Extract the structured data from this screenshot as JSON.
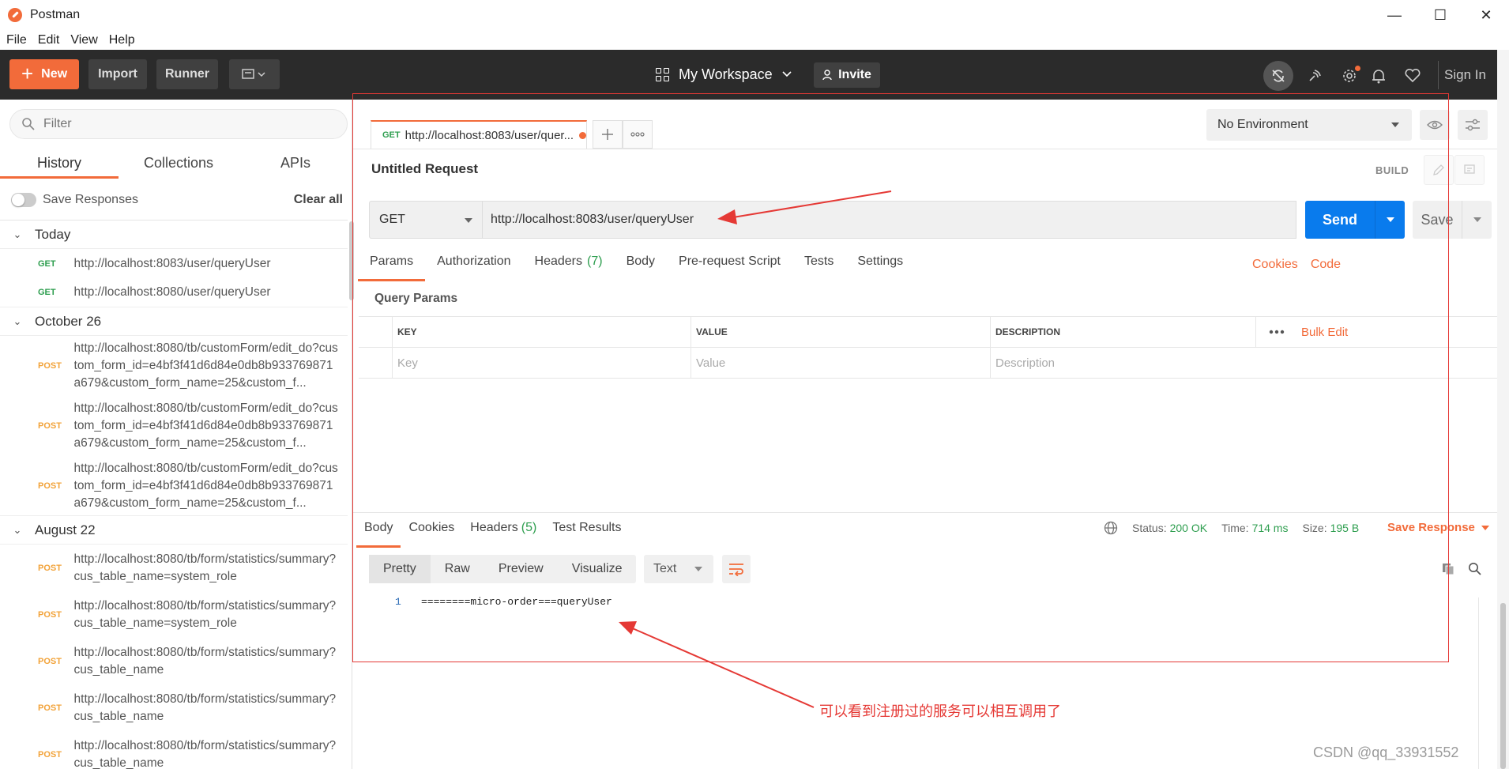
{
  "app": {
    "title": "Postman"
  },
  "window_controls": {
    "minimize": "—",
    "maximize": "☐",
    "close": "✕"
  },
  "menu": [
    "File",
    "Edit",
    "View",
    "Help"
  ],
  "header": {
    "new_label": "New",
    "import_label": "Import",
    "runner_label": "Runner",
    "workspace_label": "My Workspace",
    "invite_label": "Invite",
    "sign_in_label": "Sign In"
  },
  "sidebar": {
    "filter_placeholder": "Filter",
    "tabs": [
      "History",
      "Collections",
      "APIs"
    ],
    "save_responses_label": "Save Responses",
    "clear_all_label": "Clear all",
    "groups": [
      {
        "label": "Today",
        "items": [
          {
            "method": "GET",
            "url": "http://localhost:8083/user/queryUser"
          },
          {
            "method": "GET",
            "url": "http://localhost:8080/user/queryUser"
          }
        ]
      },
      {
        "label": "October 26",
        "items": [
          {
            "method": "POST",
            "url": "http://localhost:8080/tb/customForm/edit_do?custom_form_id=e4bf3f41d6d84e0db8b933769871a679&custom_form_name=25&custom_f..."
          },
          {
            "method": "POST",
            "url": "http://localhost:8080/tb/customForm/edit_do?custom_form_id=e4bf3f41d6d84e0db8b933769871a679&custom_form_name=25&custom_f..."
          },
          {
            "method": "POST",
            "url": "http://localhost:8080/tb/customForm/edit_do?custom_form_id=e4bf3f41d6d84e0db8b933769871a679&custom_form_name=25&custom_f..."
          }
        ]
      },
      {
        "label": "August 22",
        "items": [
          {
            "method": "POST",
            "url": "http://localhost:8080/tb/form/statistics/summary?cus_table_name=system_role"
          },
          {
            "method": "POST",
            "url": "http://localhost:8080/tb/form/statistics/summary?cus_table_name=system_role"
          },
          {
            "method": "POST",
            "url": "http://localhost:8080/tb/form/statistics/summary?cus_table_name"
          },
          {
            "method": "POST",
            "url": "http://localhost:8080/tb/form/statistics/summary?cus_table_name"
          },
          {
            "method": "POST",
            "url": "http://localhost:8080/tb/form/statistics/summary?cus_table_name"
          }
        ]
      }
    ]
  },
  "request_tab": {
    "method": "GET",
    "url": "http://localhost:8083/user/quer..."
  },
  "environment": {
    "selected": "No Environment"
  },
  "request": {
    "title": "Untitled Request",
    "build_label": "BUILD",
    "method": "GET",
    "url": "http://localhost:8083/user/queryUser",
    "send_label": "Send",
    "save_label": "Save",
    "tabs": [
      {
        "label": "Params",
        "count": ""
      },
      {
        "label": "Authorization",
        "count": ""
      },
      {
        "label": "Headers",
        "count": "(7)"
      },
      {
        "label": "Body",
        "count": ""
      },
      {
        "label": "Pre-request Script",
        "count": ""
      },
      {
        "label": "Tests",
        "count": ""
      },
      {
        "label": "Settings",
        "count": ""
      }
    ],
    "cookies_label": "Cookies",
    "code_label": "Code"
  },
  "query_params": {
    "title": "Query Params",
    "headers": [
      "KEY",
      "VALUE",
      "DESCRIPTION"
    ],
    "bulk_edit_label": "Bulk Edit",
    "placeholders": [
      "Key",
      "Value",
      "Description"
    ]
  },
  "response": {
    "tabs": [
      {
        "label": "Body",
        "count": ""
      },
      {
        "label": "Cookies",
        "count": ""
      },
      {
        "label": "Headers",
        "count": "(5)"
      },
      {
        "label": "Test Results",
        "count": ""
      }
    ],
    "status_label": "Status:",
    "status_value": "200 OK",
    "time_label": "Time:",
    "time_value": "714 ms",
    "size_label": "Size:",
    "size_value": "195 B",
    "save_response_label": "Save Response",
    "formats": [
      "Pretty",
      "Raw",
      "Preview",
      "Visualize"
    ],
    "text_type": "Text",
    "line_number": "1",
    "body": "========micro-order===queryUser"
  },
  "annotation": {
    "text": "可以看到注册过的服务可以相互调用了"
  },
  "watermark": "CSDN @qq_33931552",
  "colors": {
    "accent": "#f26b3a",
    "send": "#097bed",
    "success": "#2e9e4f",
    "annotation": "#e53935"
  }
}
